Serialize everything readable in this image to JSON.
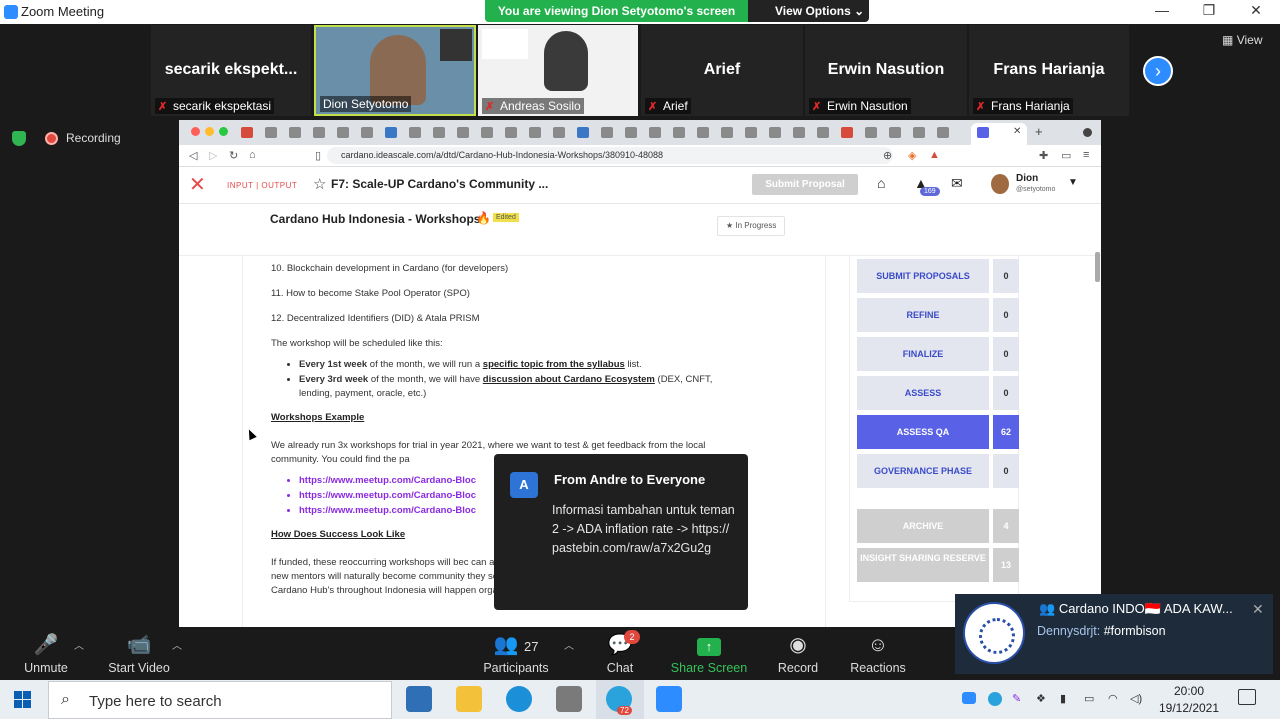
{
  "window": {
    "title": "Zoom Meeting",
    "controls": [
      "—",
      "❐",
      "✕"
    ]
  },
  "banner": {
    "viewing": "You are viewing Dion Setyotomo's screen",
    "options": "View Options"
  },
  "participants_strip": [
    {
      "big": "secarik  ekspekt...",
      "label": "secarik ekspektasi",
      "muted": true
    },
    {
      "big": "",
      "label": "Dion Setyotomo",
      "muted": false,
      "video": true
    },
    {
      "big": "",
      "label": "Andreas Sosilo",
      "muted": true,
      "video": true
    },
    {
      "big": "Arief",
      "label": "Arief",
      "muted": true
    },
    {
      "big": "Erwin Nasution",
      "label": "Erwin Nasution",
      "muted": true
    },
    {
      "big": "Frans Harianja",
      "label": "Frans Harianja",
      "muted": true
    }
  ],
  "view_button": "View",
  "recording": "Recording",
  "browser": {
    "url": "cardano.ideascale.com/a/dtd/Cardano-Hub-Indonesia-Workshops/380910-48088",
    "logo_text": "INPUT | OUTPUT",
    "campaign": "F7: Scale-UP Cardano's Community ...",
    "submit_btn": "Submit Proposal",
    "notif_count": "169",
    "user_name": "Dion",
    "user_handle": "@setyotomo",
    "idea_title": "Cardano Hub Indonesia - Workshops",
    "edited": "Edited",
    "status": "In Progress",
    "content": {
      "items": [
        "10. Blockchain development in Cardano (for developers)",
        "11. How to become Stake Pool Operator (SPO)",
        "12. Decentralized Identifiers (DID) & Atala PRISM"
      ],
      "schedule_intro": "The workshop will be scheduled like this:",
      "b1_bold": "Every 1st week",
      "b1_mid": " of the month, we will run a ",
      "b1_u": "specific topic from the syllabus",
      "b1_end": " list.",
      "b2_bold": "Every 3rd week",
      "b2_mid": " of the month, we will have ",
      "b2_u": "discussion about Cardano Ecosystem",
      "b2_end": " (DEX, CNFT, lending, payment, oracle, etc.)",
      "ex_heading": "Workshops Example",
      "ex_para": "We already run 3x workshops for trial in year 2021, where we want to test & get feedback from the local community. You could find the pa",
      "links": [
        "https://www.meetup.com/Cardano-Bloc",
        "https://www.meetup.com/Cardano-Bloc",
        "https://www.meetup.com/Cardano-Bloc"
      ],
      "success_heading": "How Does Success Look Like",
      "success_para": "If funded, these reoccurring workshops will bec can adopt and distribute. We envision new sets effort. These new mentors will naturally become community they seek to develop. Eventually the goal of creating various Cardano Hub's throughout Indonesia will happen organically. A sustained expansion, meaning financial"
    },
    "phases": [
      {
        "label": "SUBMIT PROPOSALS",
        "count": "0",
        "state": "normal"
      },
      {
        "label": "REFINE",
        "count": "0",
        "state": "normal"
      },
      {
        "label": "FINALIZE",
        "count": "0",
        "state": "normal"
      },
      {
        "label": "ASSESS",
        "count": "0",
        "state": "normal"
      },
      {
        "label": "ASSESS QA",
        "count": "62",
        "state": "active"
      },
      {
        "label": "GOVERNANCE PHASE",
        "count": "0",
        "state": "normal"
      },
      {
        "label": "ARCHIVE",
        "count": "4",
        "state": "grey"
      },
      {
        "label": "INSIGHT SHARING RESERVE",
        "count": "13",
        "state": "grey"
      }
    ]
  },
  "chat_popup": {
    "avatar": "A",
    "from": "From Andre to Everyone",
    "message": "Informasi tambahan untuk teman2 -> ADA inflation rate -> https://pastebin.com/raw/a7x2Gu2g"
  },
  "telegram": {
    "group": "Cardano INDO🇮🇩 ADA KAW...",
    "sender": "Dennysdrjt:",
    "message": "#formbison"
  },
  "toolbar": {
    "unmute": "Unmute",
    "start_video": "Start Video",
    "participants": "Participants",
    "participants_count": "27",
    "chat": "Chat",
    "chat_badge": "2",
    "share": "Share Screen",
    "record": "Record",
    "reactions": "Reactions"
  },
  "taskbar": {
    "search_placeholder": "Type here to search",
    "telegram_badge": "72",
    "time": "20:00",
    "date": "19/12/2021"
  },
  "colors": {
    "zoom_blue": "#2d8cff",
    "share_green": "#23b14d",
    "ideascale_accent": "#5961e6"
  }
}
